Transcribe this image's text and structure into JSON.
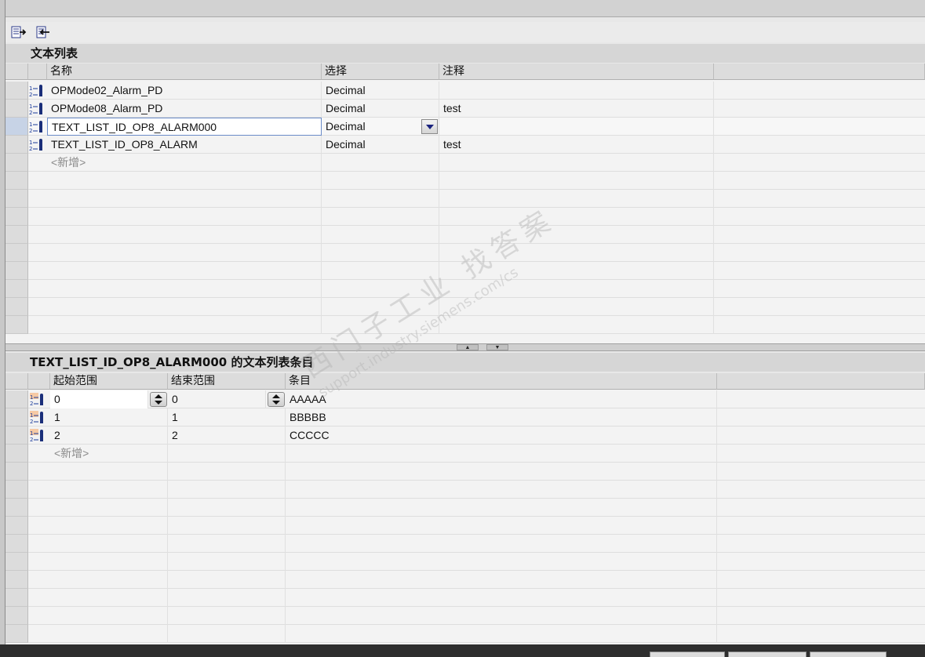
{
  "toolbar": {
    "add_icon": "insert-row-icon",
    "remove_icon": "delete-row-icon"
  },
  "text_lists": {
    "title": "文本列表",
    "columns": [
      "名称",
      "选择",
      "注释"
    ],
    "rows": [
      {
        "name": "OPMode02_Alarm_PD",
        "selection": "Decimal",
        "comment": ""
      },
      {
        "name": "OPMode08_Alarm_PD",
        "selection": "Decimal",
        "comment": "test"
      },
      {
        "name": "TEXT_LIST_ID_OP8_ALARM000",
        "selection": "Decimal",
        "comment": ""
      },
      {
        "name": "TEXT_LIST_ID_OP8_ALARM",
        "selection": "Decimal",
        "comment": "test"
      }
    ],
    "add_new": "<新增>"
  },
  "entries": {
    "title": "TEXT_LIST_ID_OP8_ALARM000 的文本列表条目",
    "columns": [
      "起始范围",
      "结束范围",
      "条目"
    ],
    "rows": [
      {
        "start": "0",
        "end": "0",
        "entry": "AAAAA"
      },
      {
        "start": "1",
        "end": "1",
        "entry": "BBBBB"
      },
      {
        "start": "2",
        "end": "2",
        "entry": "CCCCC"
      }
    ],
    "add_new": "<新增>"
  },
  "watermark": {
    "line1": "西门子工业 找答案",
    "line2": "support.industry.siemens.com/cs"
  },
  "colors": {
    "header_bg": "#dcdcdc",
    "selection_border": "#6a8bc8",
    "dropdown_arrow": "#1a237e"
  }
}
